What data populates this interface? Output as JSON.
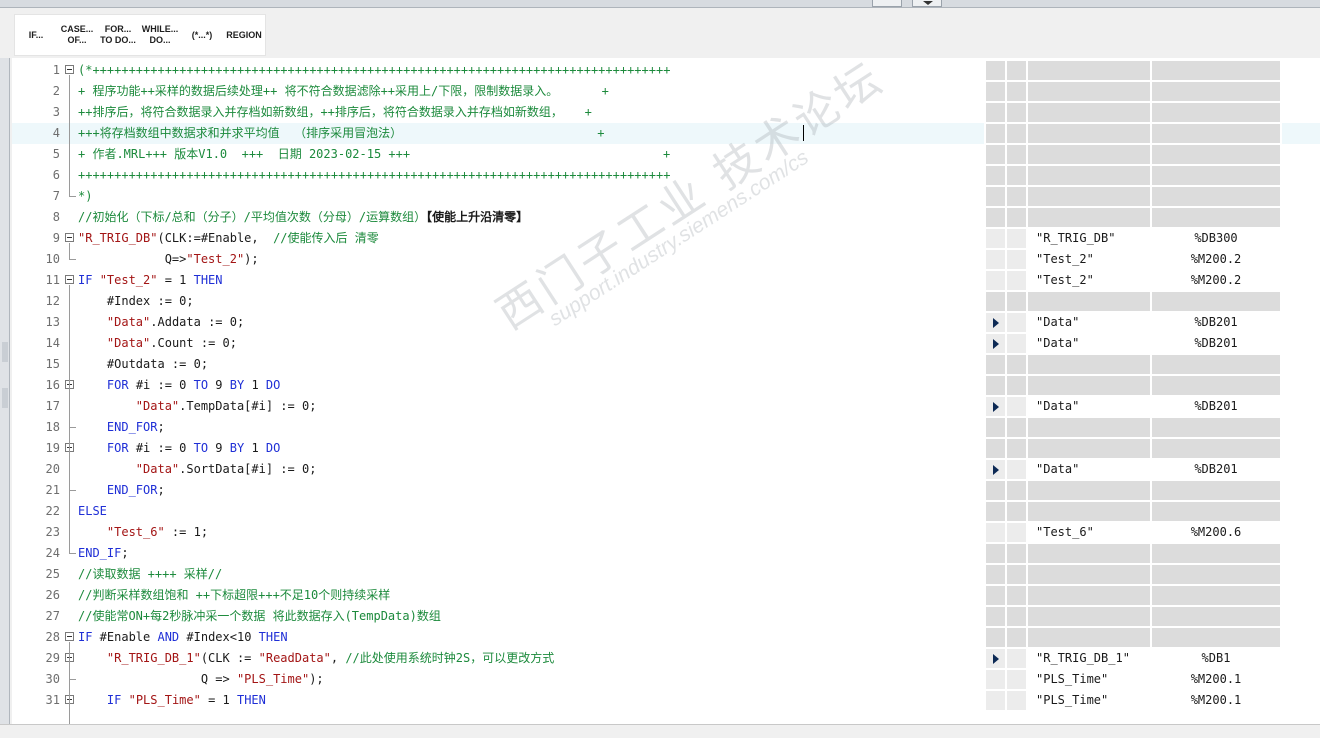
{
  "toolbar": {
    "buttons": [
      {
        "id": "if",
        "label": "IF..."
      },
      {
        "id": "case",
        "label": "CASE...\nOF..."
      },
      {
        "id": "for",
        "label": "FOR...\nTO DO..."
      },
      {
        "id": "while",
        "label": "WHILE...\nDO..."
      },
      {
        "id": "comment",
        "label": "(*...*)"
      },
      {
        "id": "region",
        "label": "REGION"
      }
    ]
  },
  "watermark": {
    "line1": "西门子工业 技术论坛",
    "line2": "support.industry.siemens.com/cs"
  },
  "editor": {
    "active_line": 4,
    "lines": [
      {
        "n": "1",
        "fold": "open",
        "tokens": [
          [
            "cm",
            "(*++++++++++++++++++++++++++++++++++++++++++++++++++++++++++++++++++++++++++++++++"
          ]
        ]
      },
      {
        "n": "2",
        "tokens": [
          [
            "cm",
            "+ 程序功能++采样的数据后续处理++ 将不符合数据滤除++采用上/下限，限制数据录入。      +"
          ]
        ]
      },
      {
        "n": "3",
        "tokens": [
          [
            "cm",
            "++排序后，将符合数据录入并存档如新数组，++排序后，将符合数据录入并存档如新数组，   +"
          ]
        ]
      },
      {
        "n": "4",
        "tokens": [
          [
            "cm",
            "+++将存档数组中数据求和并求平均值  （排序采用冒泡法）                           +"
          ]
        ]
      },
      {
        "n": "5",
        "tokens": [
          [
            "cm",
            "+ 作者.MRL+++ 版本V1.0  +++  日期 2023-02-15 +++                                   +"
          ]
        ]
      },
      {
        "n": "6",
        "tokens": [
          [
            "cm",
            "++++++++++++++++++++++++++++++++++++++++++++++++++++++++++++++++++++++++++++++++++"
          ]
        ]
      },
      {
        "n": "7",
        "fold": "end",
        "tokens": [
          [
            "cm",
            "*)"
          ]
        ]
      },
      {
        "n": "8",
        "tokens": [
          [
            "cm",
            "//初始化（下标/总和（分子）/平均值次数（分母）/运算数组）"
          ],
          [
            "bold",
            "【使能上升沿清零】"
          ]
        ]
      },
      {
        "n": "9",
        "fold": "open",
        "tokens": [
          [
            "str",
            "\"R_TRIG_DB\""
          ],
          [
            "pl",
            "(CLK:=#Enable,  "
          ],
          [
            "cm",
            "//使能传入后 清零"
          ]
        ]
      },
      {
        "n": "10",
        "fold": "end",
        "tokens": [
          [
            "pl",
            "            Q=>"
          ],
          [
            "str",
            "\"Test_2\""
          ],
          [
            "pl",
            ");"
          ]
        ]
      },
      {
        "n": "11",
        "fold": "open",
        "tokens": [
          [
            "kw",
            "IF "
          ],
          [
            "str",
            "\"Test_2\""
          ],
          [
            "pl",
            " = 1 "
          ],
          [
            "kw",
            "THEN"
          ]
        ]
      },
      {
        "n": "12",
        "tokens": [
          [
            "pl",
            "    #Index := 0;"
          ]
        ]
      },
      {
        "n": "13",
        "tokens": [
          [
            "pl",
            "    "
          ],
          [
            "str",
            "\"Data\""
          ],
          [
            "pl",
            ".Addata := 0;"
          ]
        ]
      },
      {
        "n": "14",
        "tokens": [
          [
            "pl",
            "    "
          ],
          [
            "str",
            "\"Data\""
          ],
          [
            "pl",
            ".Count := 0;"
          ]
        ]
      },
      {
        "n": "15",
        "tokens": [
          [
            "pl",
            "    #Outdata := 0;"
          ]
        ]
      },
      {
        "n": "16",
        "fold": "open",
        "tokens": [
          [
            "pl",
            "    "
          ],
          [
            "kw",
            "FOR"
          ],
          [
            "pl",
            " #i := 0 "
          ],
          [
            "kw",
            "TO"
          ],
          [
            "pl",
            " 9 "
          ],
          [
            "kw",
            "BY"
          ],
          [
            "pl",
            " 1 "
          ],
          [
            "kw",
            "DO"
          ]
        ]
      },
      {
        "n": "17",
        "tokens": [
          [
            "pl",
            "        "
          ],
          [
            "str",
            "\"Data\""
          ],
          [
            "pl",
            ".TempData[#i] := 0;"
          ]
        ]
      },
      {
        "n": "18",
        "fold": "end",
        "tokens": [
          [
            "pl",
            "    "
          ],
          [
            "kw",
            "END_FOR"
          ],
          [
            "pl",
            ";"
          ]
        ]
      },
      {
        "n": "19",
        "fold": "open",
        "tokens": [
          [
            "pl",
            "    "
          ],
          [
            "kw",
            "FOR"
          ],
          [
            "pl",
            " #i := 0 "
          ],
          [
            "kw",
            "TO"
          ],
          [
            "pl",
            " 9 "
          ],
          [
            "kw",
            "BY"
          ],
          [
            "pl",
            " 1 "
          ],
          [
            "kw",
            "DO"
          ]
        ]
      },
      {
        "n": "20",
        "tokens": [
          [
            "pl",
            "        "
          ],
          [
            "str",
            "\"Data\""
          ],
          [
            "pl",
            ".SortData[#i] := 0;"
          ]
        ]
      },
      {
        "n": "21",
        "fold": "end",
        "tokens": [
          [
            "pl",
            "    "
          ],
          [
            "kw",
            "END_FOR"
          ],
          [
            "pl",
            ";"
          ]
        ]
      },
      {
        "n": "22",
        "tokens": [
          [
            "kw",
            "ELSE"
          ]
        ]
      },
      {
        "n": "23",
        "tokens": [
          [
            "pl",
            "    "
          ],
          [
            "str",
            "\"Test_6\""
          ],
          [
            "pl",
            " := 1;"
          ]
        ]
      },
      {
        "n": "24",
        "fold": "end",
        "tokens": [
          [
            "kw",
            "END_IF"
          ],
          [
            "pl",
            ";"
          ]
        ]
      },
      {
        "n": "25",
        "tokens": [
          [
            "cm",
            "//读取数据 ++++ 采样//"
          ]
        ]
      },
      {
        "n": "26",
        "tokens": [
          [
            "cm",
            "//判断采样数组饱和 ++下标超限+++不足10个则持续采样"
          ]
        ]
      },
      {
        "n": "27",
        "tokens": [
          [
            "cm",
            "//使能常ON+每2秒脉冲采一个数据 将此数据存入(TempData)数组"
          ]
        ]
      },
      {
        "n": "28",
        "fold": "open",
        "tokens": [
          [
            "kw",
            "IF"
          ],
          [
            "pl",
            " #Enable "
          ],
          [
            "kw",
            "AND"
          ],
          [
            "pl",
            " #Index<10 "
          ],
          [
            "kw",
            "THEN"
          ]
        ]
      },
      {
        "n": "29",
        "fold": "open",
        "tokens": [
          [
            "pl",
            "    "
          ],
          [
            "str",
            "\"R_TRIG_DB_1\""
          ],
          [
            "pl",
            "(CLK := "
          ],
          [
            "str",
            "\"ReadData\""
          ],
          [
            "pl",
            ", "
          ],
          [
            "cm",
            "//此处使用系统时钟2S，可以更改方式"
          ]
        ]
      },
      {
        "n": "30",
        "fold": "end",
        "tokens": [
          [
            "pl",
            "                 Q => "
          ],
          [
            "str",
            "\"PLS_Time\""
          ],
          [
            "pl",
            ");"
          ]
        ]
      },
      {
        "n": "31",
        "fold": "open",
        "tokens": [
          [
            "pl",
            "    "
          ],
          [
            "kw",
            "IF"
          ],
          [
            "pl",
            " "
          ],
          [
            "str",
            "\"PLS_Time\""
          ],
          [
            "pl",
            " = 1 "
          ],
          [
            "kw",
            "THEN"
          ]
        ]
      }
    ]
  },
  "references": [
    {
      "line": 9,
      "tag": "\"R_TRIG_DB\"",
      "addr": "%DB300",
      "arrow": false
    },
    {
      "line": 10,
      "tag": "\"Test_2\"",
      "addr": "%M200.2",
      "arrow": false
    },
    {
      "line": 11,
      "tag": "\"Test_2\"",
      "addr": "%M200.2",
      "arrow": false
    },
    {
      "line": 13,
      "tag": "\"Data\"",
      "addr": "%DB201",
      "arrow": true
    },
    {
      "line": 14,
      "tag": "\"Data\"",
      "addr": "%DB201",
      "arrow": true
    },
    {
      "line": 17,
      "tag": "\"Data\"",
      "addr": "%DB201",
      "arrow": true
    },
    {
      "line": 20,
      "tag": "\"Data\"",
      "addr": "%DB201",
      "arrow": true
    },
    {
      "line": 23,
      "tag": "\"Test_6\"",
      "addr": "%M200.6",
      "arrow": false
    },
    {
      "line": 29,
      "tag": "\"R_TRIG_DB_1\"",
      "addr": "%DB1",
      "arrow": true
    },
    {
      "line": 30,
      "tag": "\"PLS_Time\"",
      "addr": "%M200.1",
      "arrow": false
    },
    {
      "line": 31,
      "tag": "\"PLS_Time\"",
      "addr": "%M200.1",
      "arrow": false
    }
  ]
}
